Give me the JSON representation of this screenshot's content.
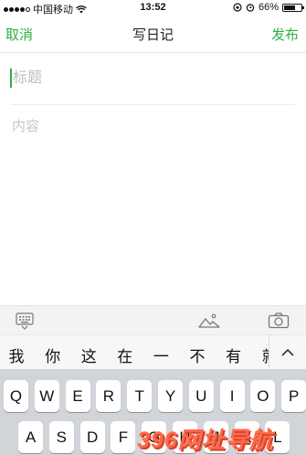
{
  "status_bar": {
    "carrier": "中国移动",
    "time": "13:52",
    "battery_percent": "66%",
    "battery_level": 0.66,
    "icons": [
      "signal-dots-icon",
      "wifi-icon",
      "rotation-lock-icon",
      "alarm-icon",
      "battery-icon"
    ]
  },
  "nav": {
    "cancel_label": "取消",
    "title": "写日记",
    "publish_label": "发布",
    "accent_color": "#2fae43"
  },
  "editor": {
    "title_placeholder": "标题",
    "content_placeholder": "内容"
  },
  "toolbar": {
    "icons": [
      "keyboard-icon",
      "image-icon",
      "camera-icon"
    ]
  },
  "candidates": [
    "我",
    "你",
    "这",
    "在",
    "一",
    "不",
    "有",
    "就"
  ],
  "keyboard": {
    "row1": [
      "Q",
      "W",
      "E",
      "R",
      "T",
      "Y",
      "U",
      "I",
      "O",
      "P"
    ],
    "row2": [
      "A",
      "S",
      "D",
      "F",
      "G",
      "H",
      "J",
      "K",
      "L"
    ]
  },
  "watermark": {
    "text": "396网址导航"
  }
}
